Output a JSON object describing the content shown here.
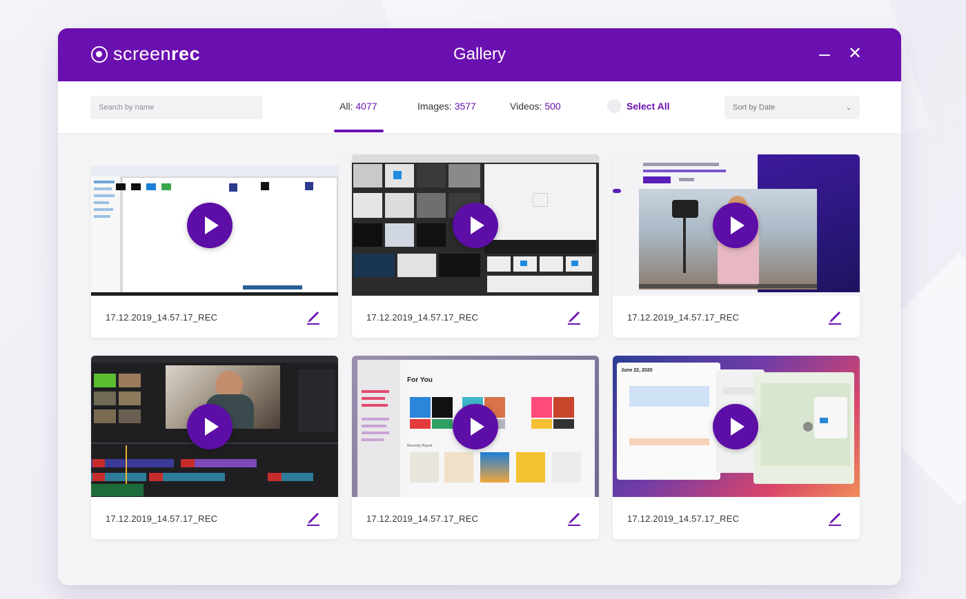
{
  "app": {
    "logo_light": "screen",
    "logo_bold": "rec",
    "title": "Gallery"
  },
  "window_controls": {
    "minimize": "–",
    "close": "✕"
  },
  "toolbar": {
    "search_placeholder": "Search by name",
    "tabs": [
      {
        "label": "All:",
        "count": "4077",
        "active": true
      },
      {
        "label": "Images:",
        "count": "3577",
        "active": false
      },
      {
        "label": "Videos:",
        "count": "500",
        "active": false
      }
    ],
    "select_all": "Select All",
    "sort_label": "Sort by Date"
  },
  "colors": {
    "brand": "#6b10b0",
    "play": "#5c0ea6"
  },
  "gallery": {
    "items": [
      {
        "name": "17.12.2019_14.57.17_REC",
        "type": "video",
        "icon": "play-icon"
      },
      {
        "name": "17.12.2019_14.57.17_REC",
        "type": "video",
        "icon": "play-icon"
      },
      {
        "name": "17.12.2019_14.57.17_REC",
        "type": "video",
        "icon": "play-icon"
      },
      {
        "name": "17.12.2019_14.57.17_REC",
        "type": "video",
        "icon": "play-icon"
      },
      {
        "name": "17.12.2019_14.57.17_REC",
        "type": "video",
        "icon": "play-icon"
      },
      {
        "name": "17.12.2019_14.57.17_REC",
        "type": "video",
        "icon": "play-icon"
      }
    ],
    "thumb_texts": {
      "music_heading": "For You",
      "recently_played": "Recently Played",
      "calendar_date": "June 22, 2020"
    }
  }
}
